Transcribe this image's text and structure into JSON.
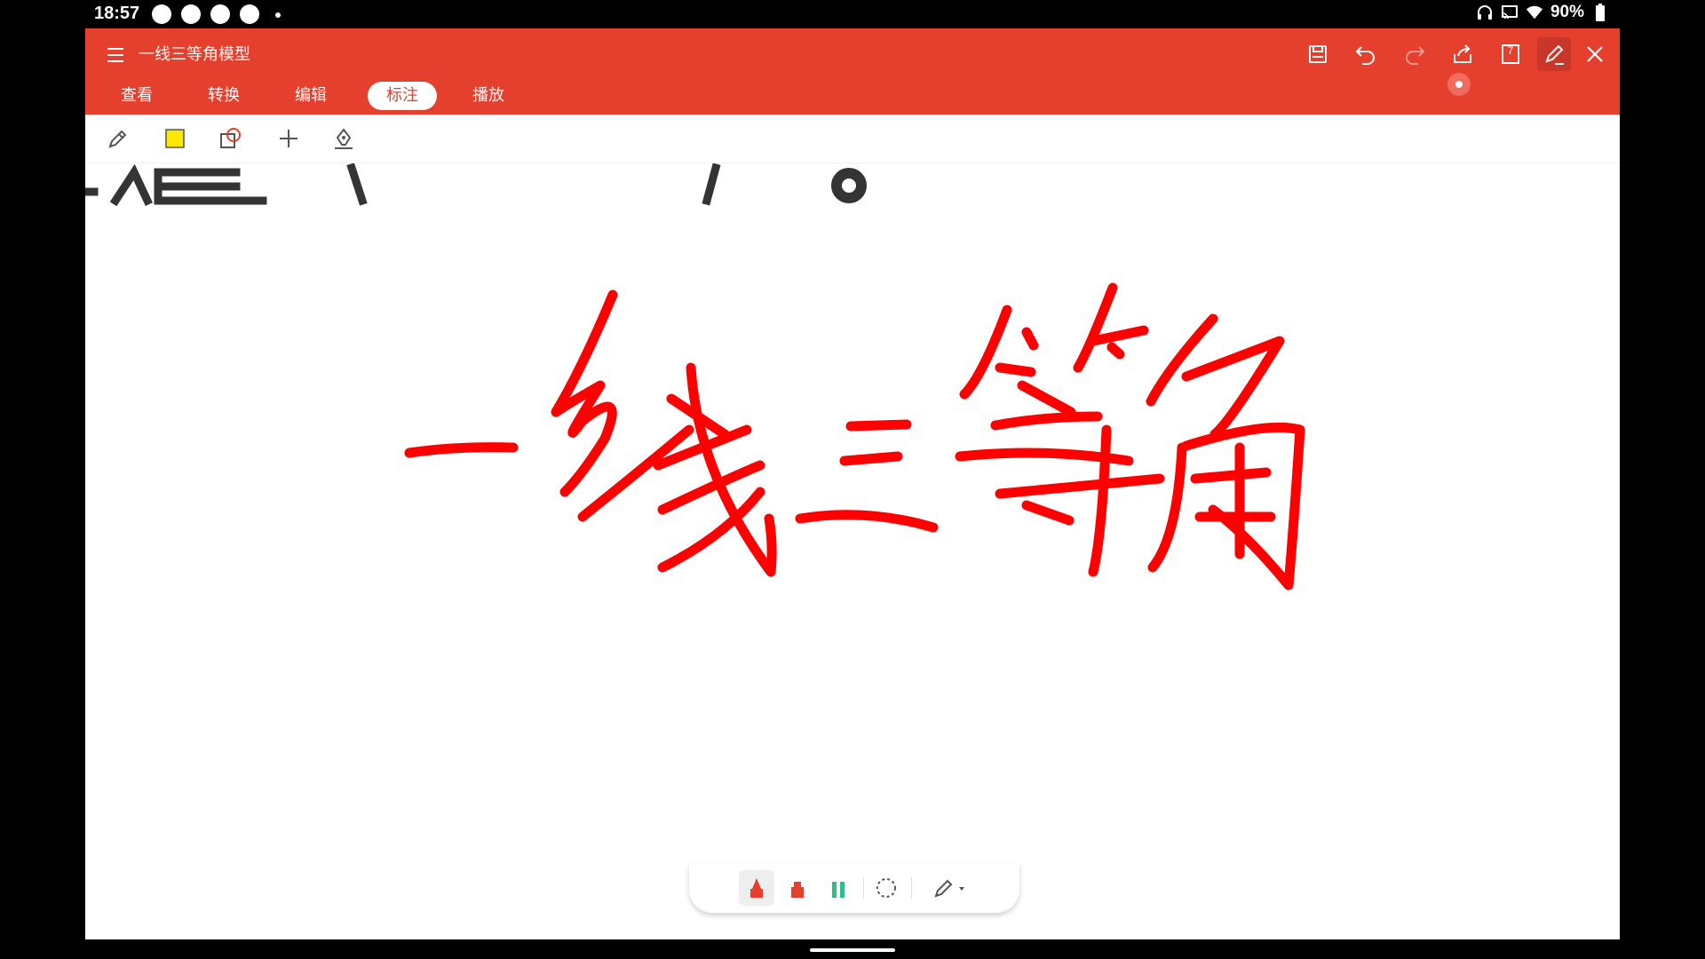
{
  "status_bar": {
    "time": "18:57",
    "battery": "90%",
    "icons": [
      "headphones-icon",
      "cast-icon",
      "wifi-icon",
      "battery-icon"
    ]
  },
  "app": {
    "title": "一线三等角模型",
    "tabs": [
      {
        "label": "查看"
      },
      {
        "label": "转换"
      },
      {
        "label": "编辑"
      },
      {
        "label": "标注"
      },
      {
        "label": "播放"
      }
    ],
    "active_tab": "标注",
    "page_number": "7",
    "accent_color": "#e53f2e"
  },
  "annotation_tools": [
    "pen-icon",
    "highlight-square-icon",
    "shape-icon",
    "add-icon",
    "signature-pen-icon"
  ],
  "canvas": {
    "handwriting": "一线三等角",
    "ink_color": "#ff0000"
  },
  "pen_bar": {
    "tools": [
      "marker-pen-icon",
      "red-marker-icon",
      "green-highlighter-icon",
      "lasso-icon",
      "eraser-pen-icon"
    ]
  }
}
